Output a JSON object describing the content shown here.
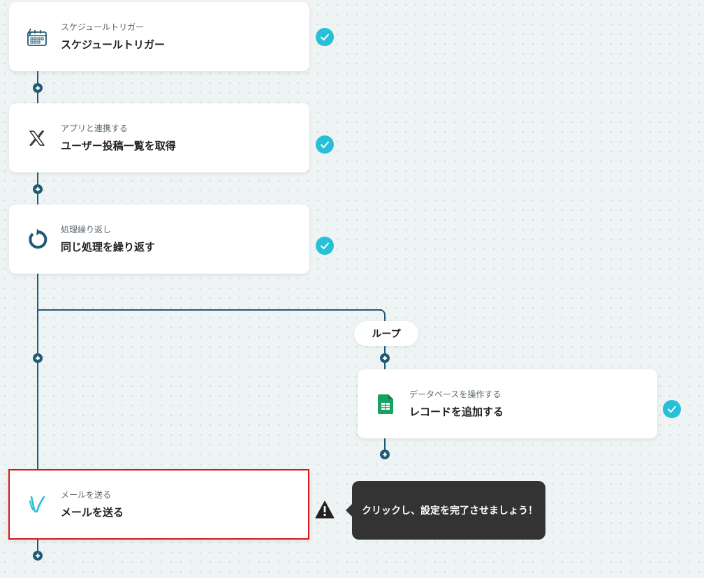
{
  "colors": {
    "connector": "#1f5c74",
    "check": "#27c0d8",
    "selected_border": "#d9171a",
    "tooltip_bg": "#333333"
  },
  "steps": [
    {
      "subtitle": "スケジュールトリガー",
      "title": "スケジュールトリガー",
      "icon": "schedule-calendar-icon",
      "status": "complete"
    },
    {
      "subtitle": "アプリと連携する",
      "title": "ユーザー投稿一覧を取得",
      "icon": "x-logo-icon",
      "status": "complete"
    },
    {
      "subtitle": "処理繰り返し",
      "title": "同じ処理を繰り返す",
      "icon": "loop-arrow-icon",
      "status": "complete"
    },
    {
      "subtitle": "データベースを操作する",
      "title": "レコードを追加する",
      "icon": "google-sheets-icon",
      "status": "complete"
    },
    {
      "subtitle": "メールを送る",
      "title": "メールを送る",
      "icon": "mail-send-icon",
      "status": "incomplete"
    }
  ],
  "loop_label": "ループ",
  "tooltip": {
    "text": "クリックし、設定を完了させましょう！",
    "icon": "warning-icon"
  }
}
